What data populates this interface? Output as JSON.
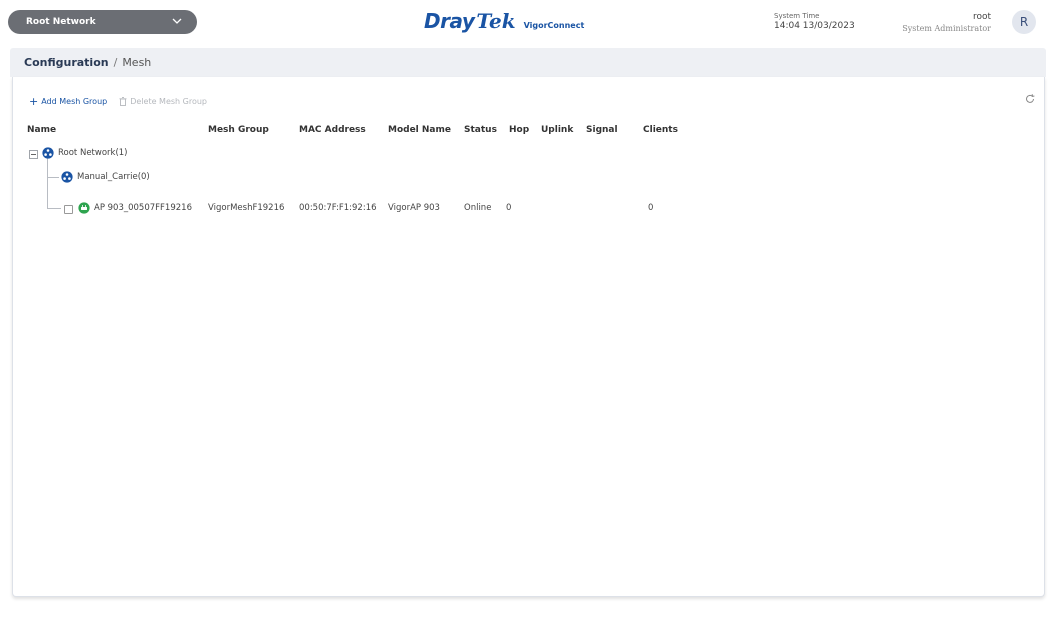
{
  "header": {
    "network_select": "Root Network",
    "logo_dray": "Dray",
    "logo_tek": "Tek",
    "logo_app": "VigorConnect",
    "system_time_label": "System Time",
    "system_time_value": "14:04 13/03/2023",
    "username": "root",
    "user_role": "System Administrator",
    "avatar_letter": "R"
  },
  "breadcrumb": {
    "section": "Configuration",
    "separator": "/",
    "page": "Mesh"
  },
  "toolbar": {
    "add_label": "Add Mesh Group",
    "delete_label": "Delete Mesh Group"
  },
  "table": {
    "columns": [
      "Name",
      "Mesh Group",
      "MAC Address",
      "Model Name",
      "Status",
      "Hop",
      "Uplink",
      "Signal",
      "Clients"
    ],
    "root": {
      "name": "Root Network(1)"
    },
    "group": {
      "name": "Manual_Carrie(0)"
    },
    "device": {
      "name": "AP 903_00507FF19216",
      "mesh_group": "VigorMeshF19216",
      "mac": "00:50:7F:F1:92:16",
      "model": "VigorAP 903",
      "status": "Online",
      "hop": "0",
      "uplink": "",
      "signal": "",
      "clients": "0"
    }
  },
  "colors": {
    "brand_blue": "#1a54a4",
    "online_green": "#2ea44f",
    "select_bg": "#6b6e74"
  }
}
